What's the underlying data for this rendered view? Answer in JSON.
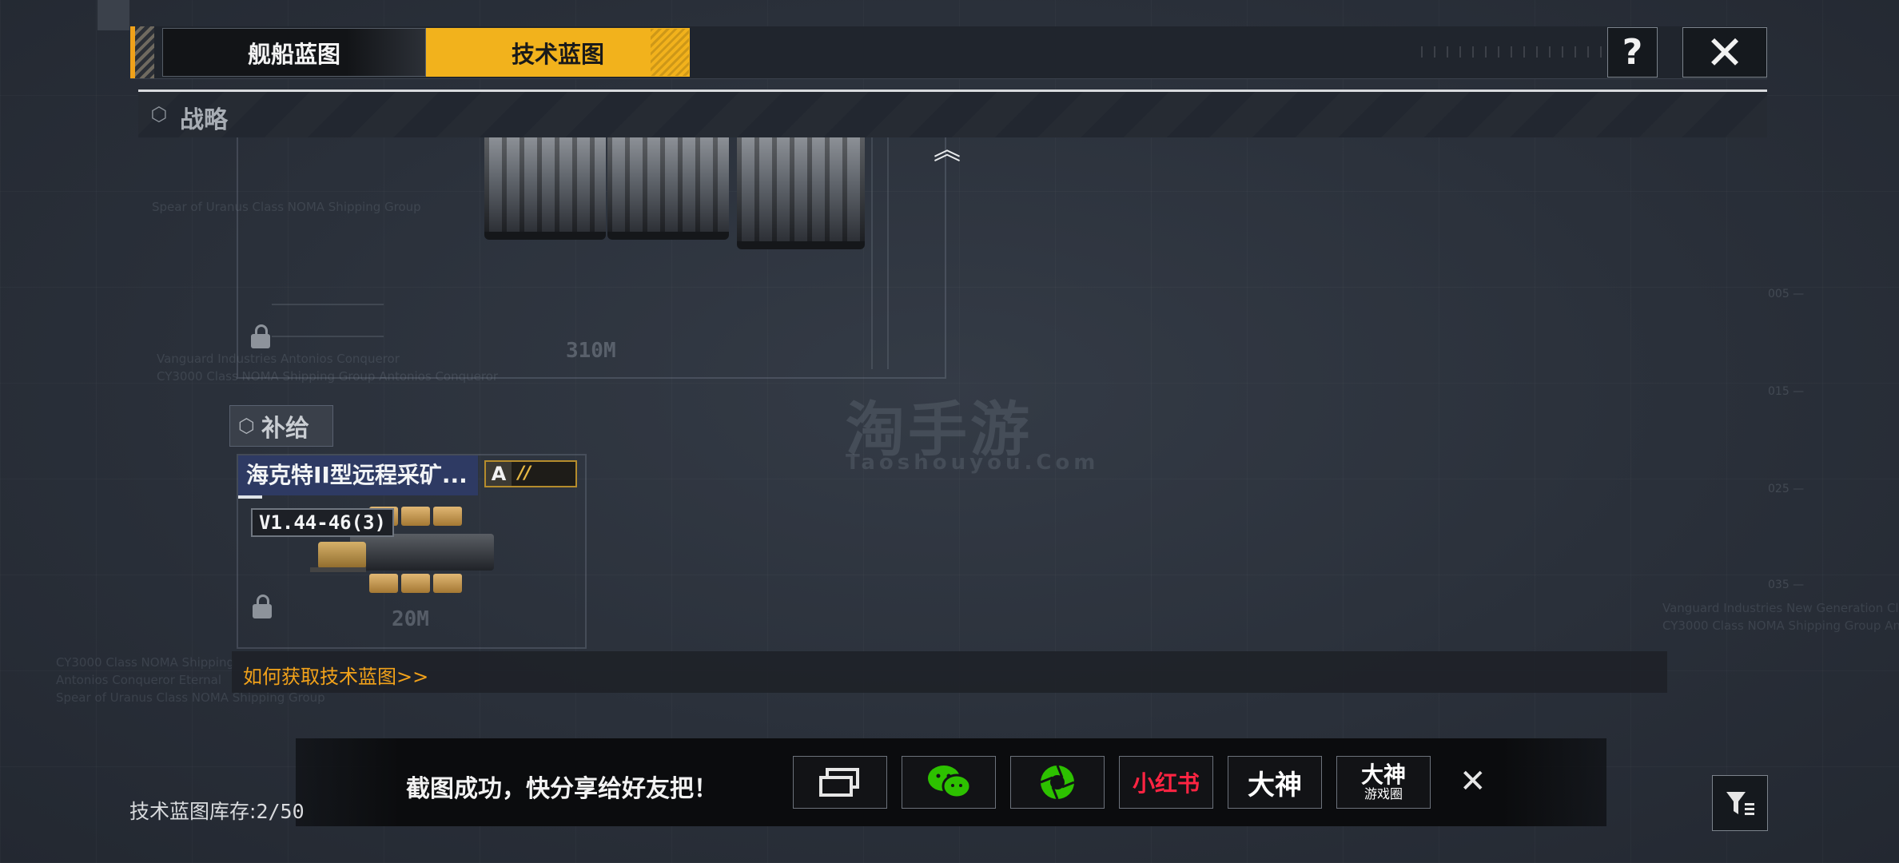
{
  "tabs": [
    {
      "label": "舰船蓝图",
      "active": false
    },
    {
      "label": "技术蓝图",
      "active": true
    }
  ],
  "header_buttons": {
    "help": "?",
    "close": "✕"
  },
  "section": {
    "label": "战略"
  },
  "blueprint_top": {
    "dimension": "310M"
  },
  "supply": {
    "category_label": "补给",
    "item": {
      "name": "海克特II型远程采矿...",
      "grade": "A",
      "grade_marks": "//",
      "version": "V1.44-46(3)",
      "dimension": "20M"
    }
  },
  "howto_link": "如何获取技术蓝图>>",
  "share": {
    "message": "截图成功，快分享给好友把！",
    "buttons": [
      {
        "name": "screenshot-share",
        "label": ""
      },
      {
        "name": "wechat",
        "label": ""
      },
      {
        "name": "moments",
        "label": ""
      },
      {
        "name": "xiaohongshu",
        "label": "小红书"
      },
      {
        "name": "dashen",
        "label": "大神"
      },
      {
        "name": "dashen-circle",
        "label": "大神",
        "sublabel": "游戏圈"
      }
    ],
    "close": "✕"
  },
  "inventory": {
    "label": "技术蓝图库存:",
    "value": "2/50"
  },
  "watermark": {
    "cn": "淘手游",
    "en": "Taoshouyou.Com"
  },
  "colors": {
    "accent": "#f2b21c",
    "link": "#f2a21a",
    "wechat": "#2dc100",
    "xhs": "#ff2442"
  },
  "icons": {
    "help": "question-icon",
    "close": "close-icon",
    "filter": "filter-icon",
    "lock": "lock-icon",
    "collapse": "chevron-up-icon"
  }
}
